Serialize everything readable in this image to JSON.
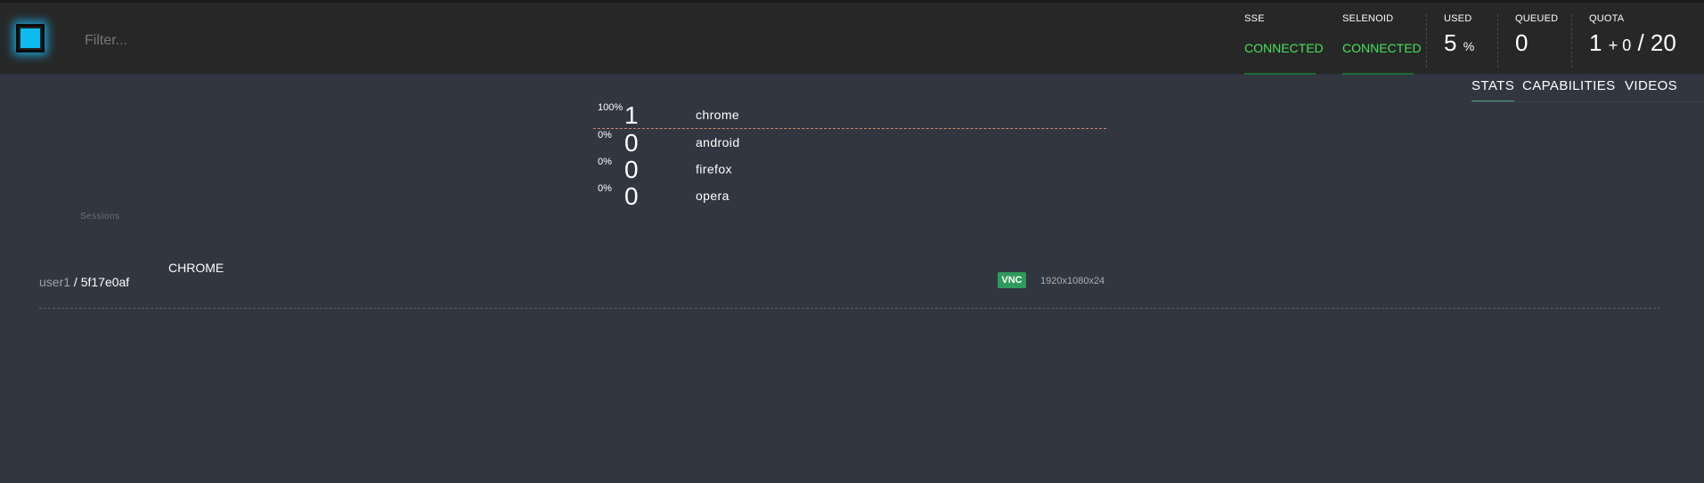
{
  "header": {
    "filter_placeholder": "Filter...",
    "sse": {
      "label": "SSE",
      "status": "CONNECTED"
    },
    "selenoid": {
      "label": "SELENOID",
      "status": "CONNECTED"
    },
    "used": {
      "label": "USED",
      "value": "5",
      "unit": "%"
    },
    "queued": {
      "label": "QUEUED",
      "value": "0"
    },
    "quota": {
      "label": "QUOTA",
      "used": "1",
      "plus": "+ 0",
      "total": "/ 20"
    }
  },
  "tabs": [
    {
      "label": "STATS",
      "active": true
    },
    {
      "label": "CAPABILITIES",
      "active": false
    },
    {
      "label": "VIDEOS",
      "active": false
    }
  ],
  "browsers": [
    {
      "percent": "100%",
      "count": "1",
      "name": "chrome"
    },
    {
      "percent": "0%",
      "count": "0",
      "name": "android"
    },
    {
      "percent": "0%",
      "count": "0",
      "name": "firefox"
    },
    {
      "percent": "0%",
      "count": "0",
      "name": "opera"
    }
  ],
  "sessions": {
    "label": "Sessions",
    "items": [
      {
        "browser": "CHROME",
        "user": "user1",
        "separator": " / ",
        "id": "5f17e0af",
        "vnc": "VNC",
        "resolution": "1920x1080x24"
      }
    ]
  },
  "colors": {
    "connected": "#46e35a",
    "vnc": "#2e9a5c",
    "accent_line": "#c98a72",
    "logo": "#0cbcf0"
  }
}
